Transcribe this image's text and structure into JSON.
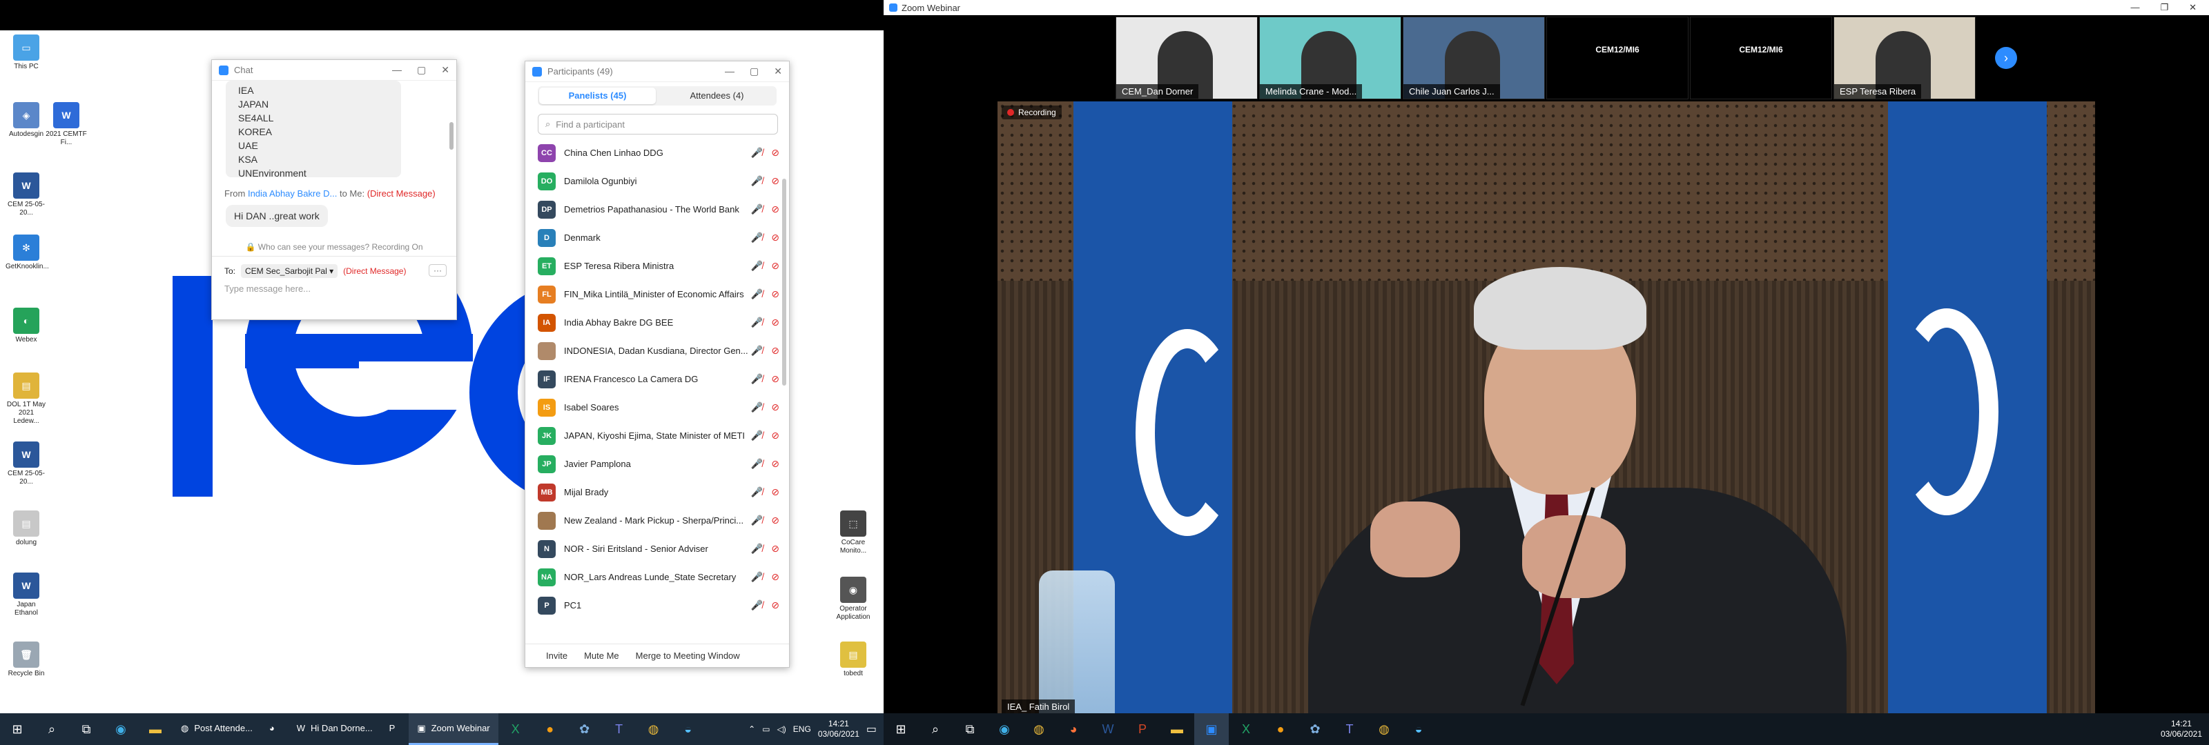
{
  "left": {
    "desktop_icons": [
      {
        "label": "This PC",
        "color": "#4aa3e6",
        "glyph": "▭"
      },
      {
        "label": "Autodesgin",
        "color": "#5b87c9",
        "glyph": "◈"
      },
      {
        "label": "2021 CEMTF Fi...",
        "color": "#2e6bd8",
        "glyph": "W"
      },
      {
        "label": "CEM 25-05-20...",
        "color": "#2b579a",
        "glyph": "W"
      },
      {
        "label": "GetKnooklin...",
        "color": "#2b7fd8",
        "glyph": "✻"
      },
      {
        "label": "Webex",
        "color": "#25a35a",
        "glyph": "◐"
      },
      {
        "label": "DOL 1T May 2021 Ledew...",
        "color": "#e0b43a",
        "glyph": "▤"
      },
      {
        "label": "CEM 25-05-20...",
        "color": "#2b579a",
        "glyph": "W"
      },
      {
        "label": "dolung",
        "color": "#c8c8c8",
        "glyph": "▤"
      },
      {
        "label": "Japan Ethanol",
        "color": "#2b579a",
        "glyph": "W"
      },
      {
        "label": "Recycle Bin",
        "color": "#9aa7b3",
        "glyph": "🗑"
      },
      {
        "label": "CoCare Monito...",
        "color": "#444444",
        "glyph": "⬚"
      },
      {
        "label": "Operator Application",
        "color": "#555555",
        "glyph": "◉"
      },
      {
        "label": "tobedt",
        "color": "#e0c040",
        "glyph": "▤"
      }
    ],
    "chat": {
      "title": "Chat",
      "list_items": [
        "IEA",
        "JAPAN",
        "SE4ALL",
        "KOREA",
        "UAE",
        "KSA",
        "UNEnvironment"
      ],
      "from_prefix": "From",
      "from_name": "India Abhay Bakre D...",
      "to_me": "to Me:",
      "direct_label": "(Direct Message)",
      "message": "Hi DAN ..great work",
      "notice": "Who can see your messages? Recording On",
      "to_label": "To:",
      "recipient": "CEM Sec_Sarbojit Pal",
      "recipient_direct": "(Direct Message)",
      "more": "···",
      "input_placeholder": "Type message here..."
    },
    "participants": {
      "title": "Participants (49)",
      "tab_panelists": "Panelists (45)",
      "tab_attendees": "Attendees (4)",
      "search_placeholder": "Find a participant",
      "rows": [
        {
          "initials": "CC",
          "color": "#8e44ad",
          "name": "China Chen Linhao DDG"
        },
        {
          "initials": "DO",
          "color": "#27ae60",
          "name": "Damilola Ogunbiyi"
        },
        {
          "initials": "DP",
          "color": "#34495e",
          "name": "Demetrios Papathanasiou - The World Bank"
        },
        {
          "initials": "D",
          "color": "#2980b9",
          "name": "Denmark"
        },
        {
          "initials": "ET",
          "color": "#27ae60",
          "name": "ESP Teresa Ribera Ministra"
        },
        {
          "initials": "FL",
          "color": "#e67e22",
          "name": "FIN_Mika Lintilä_Minister of Economic Affairs"
        },
        {
          "initials": "IA",
          "color": "#d35400",
          "name": "India Abhay Bakre DG BEE"
        },
        {
          "initials": "",
          "color": "#b08a6a",
          "name": "INDONESIA, Dadan Kusdiana, Director Gen..."
        },
        {
          "initials": "IF",
          "color": "#34495e",
          "name": "IRENA Francesco La Camera DG"
        },
        {
          "initials": "IS",
          "color": "#f39c12",
          "name": "Isabel Soares"
        },
        {
          "initials": "JK",
          "color": "#27ae60",
          "name": "JAPAN, Kiyoshi Ejima, State Minister of METI"
        },
        {
          "initials": "JP",
          "color": "#27ae60",
          "name": "Javier Pamplona"
        },
        {
          "initials": "MB",
          "color": "#c0392b",
          "name": "Mijal Brady"
        },
        {
          "initials": "",
          "color": "#a07850",
          "name": "New Zealand - Mark Pickup - Sherpa/Princi..."
        },
        {
          "initials": "N",
          "color": "#34495e",
          "name": "NOR - Siri Eritsland - Senior Adviser"
        },
        {
          "initials": "NA",
          "color": "#27ae60",
          "name": "NOR_Lars Andreas Lunde_State Secretary"
        },
        {
          "initials": "P",
          "color": "#34495e",
          "name": "PC1"
        }
      ],
      "invite": "Invite",
      "mute_me": "Mute Me",
      "merge": "Merge to Meeting Window"
    },
    "taskbar": {
      "apps": [
        {
          "label": "Post Attende...",
          "icon": "chrome-icon",
          "glyph": "◍",
          "active": false
        },
        {
          "label": "",
          "icon": "firefox-icon",
          "glyph": "◕",
          "active": false
        },
        {
          "label": "Hi Dan Dorne...",
          "icon": "word-icon",
          "glyph": "W",
          "active": false
        },
        {
          "label": "",
          "icon": "powerpoint-icon",
          "glyph": "P",
          "active": false
        },
        {
          "label": "Zoom Webinar",
          "icon": "zoom-icon",
          "glyph": "▣",
          "active": true
        }
      ],
      "lang": "ENG",
      "time": "14:21",
      "date": "03/06/2021"
    }
  },
  "right": {
    "window_title": "Zoom Webinar",
    "thumbnails": [
      {
        "name": "CEM_Dan Dorner",
        "bg": "#e8e8e8"
      },
      {
        "name": "Melinda Crane - Mod...",
        "bg": "#6ecac8"
      },
      {
        "name": "Chile Juan Carlos J...",
        "bg": "#4a6a90"
      },
      {
        "name": "",
        "bg": "#000000"
      },
      {
        "name": "",
        "bg": "#000000"
      },
      {
        "name": "ESP Teresa Ribera",
        "bg": "#d8d0c0"
      }
    ],
    "thumb_logo": "CEM12/MI6",
    "recording_label": "Recording",
    "speaker_name": "IEA_ Fatih Birol",
    "taskbar_time": "14:21",
    "taskbar_date": "03/06/2021"
  }
}
